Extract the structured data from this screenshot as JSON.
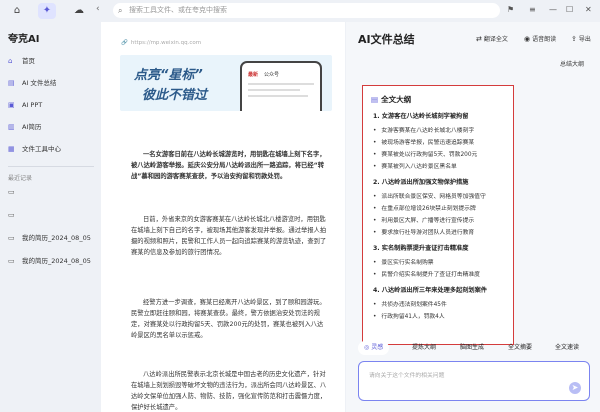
{
  "topbar": {
    "search_placeholder": "搜索工具文件、或在夸克中搜索"
  },
  "sidebar": {
    "brand": "夸克AI",
    "items": [
      {
        "label": "首页"
      },
      {
        "label": "AI 文件总结"
      },
      {
        "label": "AI PPT"
      },
      {
        "label": "AI简历"
      },
      {
        "label": "文件工具中心"
      }
    ],
    "recent_title": "最近记录",
    "recent": [
      {
        "label": ""
      },
      {
        "label": ""
      },
      {
        "label": "我的简历_2024_08_05"
      },
      {
        "label": "我的简历_2024_08_05"
      }
    ]
  },
  "doc": {
    "url": "https://mp.weixin.qq.com",
    "banner_line1": "点亮“星标”",
    "banner_line2": "彼此不错过",
    "phone_brand": "最新",
    "phone_text": "公众号",
    "p1": "一名女游客日前在八达岭长城游览时，用钥匙在城墙上刻下名字，被八达岭游客举报。延庆公安分局八达岭派出所一路追踪，将已经“转战”慕和园的游客赛某查获，予以治安拘留和罚款处罚。",
    "p2": "日前，外省来京的女游客赛某在八达岭长城北八楼游览时，用钥匙在城墙上刻下自己的名字，被现场其他游客发现并举报。通过举报人拍摄的视频和照片，民警和工作人员一起向追踪赛某的游览轨迹，查到了赛某的信息及参加的旅行团情况。",
    "p3": "经警方进一步调查，赛某已经离开八达岭景区，到了颐和园游玩。民警立即赶往颐和园，将赛某查获。最终，警方依据治安处罚法的规定，对赛某处以行政拘留5天、罚款200元的处罚，赛某也被列入八达岭景区的黑名单以示惩戒。",
    "p4": "八达岭派出所民警表示北京长城是中国古老的历史文化遗产，针对在城墙上刻划损毁等破坏文物的违法行为，派出所会同八达岭景区、八达岭文保单位加强人防、物防、技防，强化宣传防范和打击震慑力度，保护好长城遗产。"
  },
  "panel": {
    "title": "AI文件总结",
    "actions": [
      {
        "label": "翻译全文"
      },
      {
        "label": "语音朗读"
      },
      {
        "label": "导出"
      }
    ],
    "summary_link": "总结大纲",
    "outline": {
      "heading": "全文大纲",
      "s1": "1. 女游客在八达岭长城刻字被拘留",
      "b1": [
        "女游客赛某在八达岭长城北八楼刻字",
        "被现场游客举报，民警迅速追踪赛某",
        "赛某被处以行政拘留5天、罚款200元",
        "赛某被列入八达岭景区黑名单"
      ],
      "s2": "2. 八达岭派出所加强文物保护措施",
      "b2": [
        "派出所联合景区保安、网格员等加强值守",
        "在重点部位增设26块禁止刻划提示牌",
        "利用景区大屏、广播等进行宣传提示",
        "要求旅行社导游对团队人员进行教育"
      ],
      "s3": "3. 实名制购票提升查证打击精准度",
      "b3": [
        "景区实行实名制购票",
        "民警介绍实名制提升了查证打击精准度"
      ],
      "s4": "4. 八达岭派出所三年来处理多起刻划案件",
      "b4": [
        "共侦办违法刻划案件45件",
        "行政拘留41人，罚款4人"
      ]
    },
    "chips": [
      "灵感",
      "提炼大纲",
      "脑图生成",
      "全文摘要",
      "全文速读"
    ],
    "ask_placeholder": "请向关于这个文件的相关问题"
  }
}
